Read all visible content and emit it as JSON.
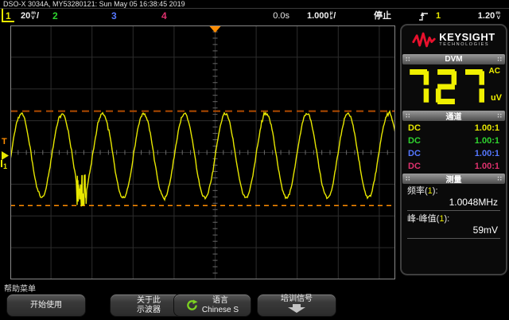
{
  "title_bar": {
    "text": "DSO-X 3034A, MY53280121: Sun May 05 16:38:45 2019"
  },
  "status_bar": {
    "channels": [
      {
        "num": "1",
        "scale": "20",
        "unit_top": "m",
        "unit_bottom": "V",
        "suffix": "/",
        "color": "#e8e800"
      },
      {
        "num": "2",
        "color": "#2fd52f"
      },
      {
        "num": "3",
        "color": "#5577ff"
      },
      {
        "num": "4",
        "color": "#e0316e"
      }
    ],
    "h_offset": "0.0s",
    "timebase": "1.000",
    "timebase_unit_top": "µ",
    "timebase_unit_bottom": "s",
    "timebase_suffix": "/",
    "run_state": "停止",
    "trigger": {
      "source": "1",
      "level": "1.20",
      "unit_top": "m",
      "unit_bottom": "V"
    }
  },
  "plot": {
    "trigger_marker": "T",
    "ground_marker_label": "1"
  },
  "right_panel": {
    "logo": {
      "brand": "KEYSIGHT",
      "sub": "TECHNOLOGIES"
    },
    "dvm": {
      "header": "DVM",
      "value": "727",
      "mode": "AC",
      "unit": "uV"
    },
    "channels": {
      "header": "通道",
      "rows": [
        {
          "coupling": "DC",
          "probe": "1.00:1",
          "color": "#e8e800"
        },
        {
          "coupling": "DC",
          "probe": "1.00:1",
          "color": "#2fd52f"
        },
        {
          "coupling": "DC",
          "probe": "1.00:1",
          "color": "#5577ff"
        },
        {
          "coupling": "DC",
          "probe": "1.00:1",
          "color": "#e0316e"
        }
      ]
    },
    "measurements": {
      "header": "测量",
      "items": [
        {
          "prefix": "频率(",
          "src": "1",
          "suffix": "):",
          "value": "1.0048MHz"
        },
        {
          "prefix": "峰-峰值(",
          "src": "1",
          "suffix": "):",
          "value": "59mV"
        }
      ]
    }
  },
  "softkeys": {
    "menu_label": "帮助菜单",
    "buttons": [
      {
        "line1": "开始使用",
        "line2": ""
      },
      {
        "line1": "关于此",
        "line2": "示波器"
      },
      {
        "line1": "语言",
        "line2": "Chinese S",
        "icon": "cycle-icon"
      },
      {
        "line1": "培训信号",
        "icon": "down-arrow-icon"
      }
    ]
  },
  "colors": {
    "trace": "#e8e800",
    "grid": "#2d2d2d",
    "tick": "#6a6a6a",
    "border": "#888888",
    "cursor_upper": "#b04a00",
    "cursor_lower": "#ff8c00",
    "seven_seg": "#f0f000",
    "brand_red": "#e8112d"
  },
  "chart_data": {
    "type": "line",
    "instrument": "oscilloscope",
    "waveform": "sine",
    "time_per_div_us": 1.0,
    "h_divisions": 10,
    "v_divisions": 8,
    "volts_per_div_mv": 20,
    "sine_frequency_mhz": 1.0048,
    "sine_amplitude_mv": 26.5,
    "measured_frequency": "1.0048MHz",
    "measured_peak_to_peak": "59mV",
    "dvm_reading": "727 uV AC",
    "trigger_level_mv": 1.2,
    "delay": "0.0s",
    "ground_offset_mv": -2.0,
    "cursor_upper_mv": 28.0,
    "cursor_lower_mv": -31.5,
    "glitch_time_us": -3.25,
    "noise_mv": 1.5
  }
}
